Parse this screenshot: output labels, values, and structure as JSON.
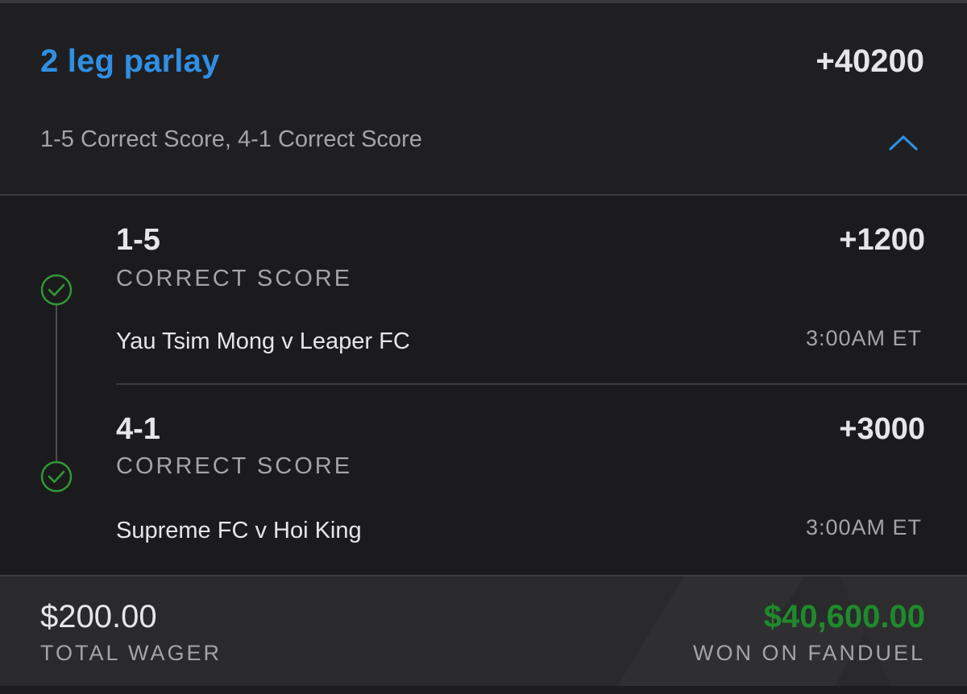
{
  "parlay": {
    "title": "2 leg parlay",
    "odds": "+40200",
    "summary": "1-5 Correct Score, 4-1 Correct Score",
    "collapse_icon": "chevron-up-icon",
    "accent_color": "#2f8fe3"
  },
  "legs": [
    {
      "score": "1-5",
      "market": "CORRECT SCORE",
      "match": "Yau Tsim Mong v Leaper FC",
      "odds": "+1200",
      "time": "3:00AM ET",
      "status_icon": "check-circle-icon"
    },
    {
      "score": "4-1",
      "market": "CORRECT SCORE",
      "match": "Supreme FC v Hoi King",
      "odds": "+3000",
      "time": "3:00AM ET",
      "status_icon": "check-circle-icon"
    }
  ],
  "footer": {
    "wager_amount": "$200.00",
    "wager_label": "TOTAL WAGER",
    "won_amount": "$40,600.00",
    "won_label": "WON ON FANDUEL",
    "won_color": "#1f8a2b"
  }
}
